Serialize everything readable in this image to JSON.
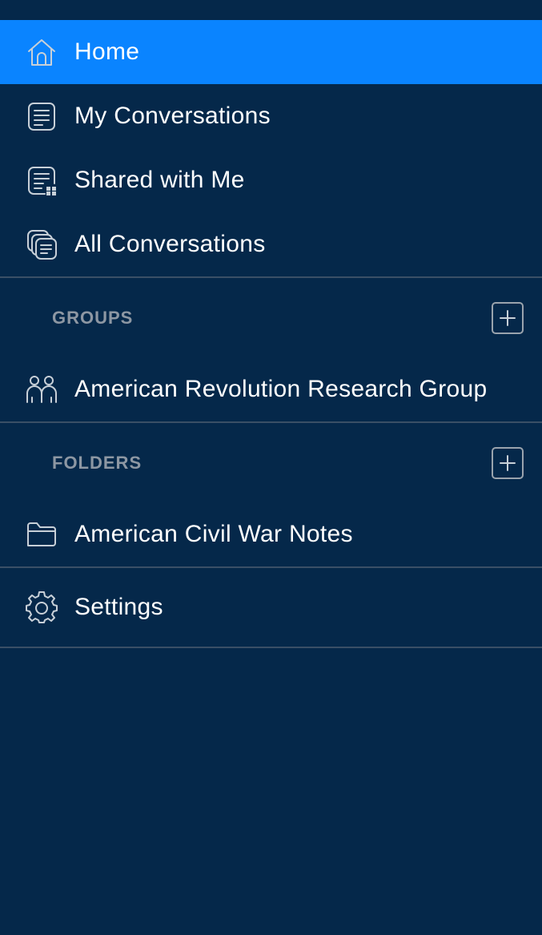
{
  "menu": {
    "home": {
      "label": "Home",
      "icon": "home-icon",
      "active": true
    },
    "my_conversations": {
      "label": "My Conversations",
      "icon": "document-icon"
    },
    "shared_with_me": {
      "label": "Shared with Me",
      "icon": "shared-document-icon"
    },
    "all_conversations": {
      "label": "All Conversations",
      "icon": "stacked-documents-icon"
    }
  },
  "groups": {
    "title": "GROUPS",
    "add_icon": "plus-icon",
    "items": [
      {
        "label": "American Revolution Research Group",
        "icon": "people-icon"
      }
    ]
  },
  "folders": {
    "title": "FOLDERS",
    "add_icon": "plus-icon",
    "items": [
      {
        "label": "American Civil War Notes",
        "icon": "folder-icon"
      }
    ]
  },
  "settings": {
    "label": "Settings",
    "icon": "gear-icon"
  },
  "colors": {
    "background": "#05284a",
    "active_item": "#0a84ff",
    "divider": "#3a4f66",
    "section_title": "#8d97a3",
    "icon_stroke": "#c8d0d8"
  }
}
